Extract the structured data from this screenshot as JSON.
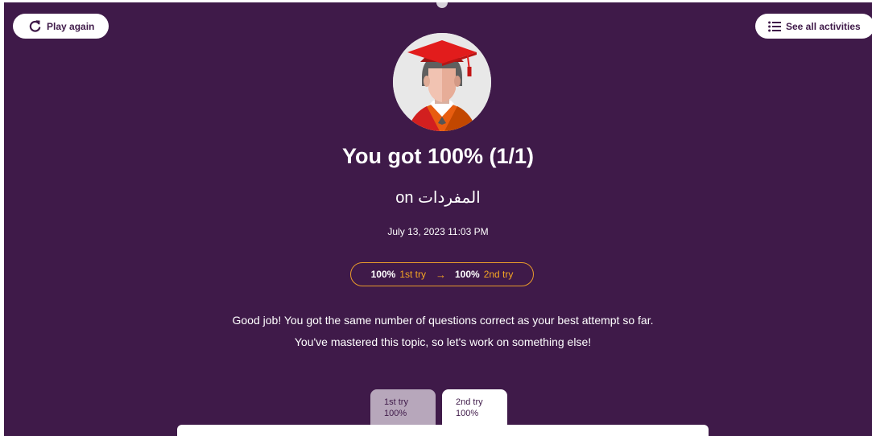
{
  "header": {
    "play_again_label": "Play again",
    "see_all_label": "See all activities"
  },
  "result": {
    "title": "You got 100% (1/1)",
    "subject_prefix": "on ",
    "subject": "المفردات",
    "datetime": "July 13, 2023 11:03 PM"
  },
  "attempts": {
    "first_pct": "100%",
    "first_label": "1st try",
    "second_pct": "100%",
    "second_label": "2nd try"
  },
  "message": {
    "line1": "Good job! You got the same number of questions correct as your best attempt so far.",
    "line2": "You've mastered this topic, so let's work on something else!"
  },
  "tabs": [
    {
      "label": "1st try",
      "value": "100%",
      "active": false
    },
    {
      "label": "2nd try",
      "value": "100%",
      "active": true
    }
  ],
  "icons": {
    "play_again": "redo-icon",
    "see_all": "list-icon",
    "avatar": "graduate-avatar"
  },
  "colors": {
    "background": "#3f1a49",
    "accent": "#f5a623",
    "button_bg": "#ffffff"
  }
}
